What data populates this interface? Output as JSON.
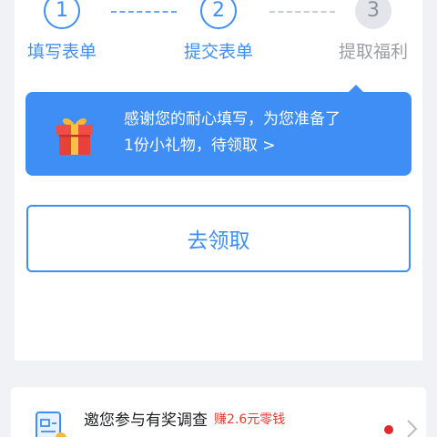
{
  "steps": [
    {
      "number": "1",
      "label": "填写表单",
      "state": "done"
    },
    {
      "number": "2",
      "label": "提交表单",
      "state": "done"
    },
    {
      "number": "3",
      "label": "提取福利",
      "state": "pending"
    }
  ],
  "banner": {
    "line1": "感谢您的耐心填写，为您准备了",
    "line2": "1份小礼物，待领取 >",
    "icon": "gift-icon"
  },
  "claim_button": {
    "label": "去领取"
  },
  "survey": {
    "title": "邀您参与有奖调查",
    "reward": "赚2.6元零钱",
    "icon": "survey-form-icon"
  },
  "colors": {
    "accent": "#3f8ef5",
    "reward_red": "#e8392f",
    "dot_red": "#e5262b",
    "background": "#f1f2f5"
  }
}
